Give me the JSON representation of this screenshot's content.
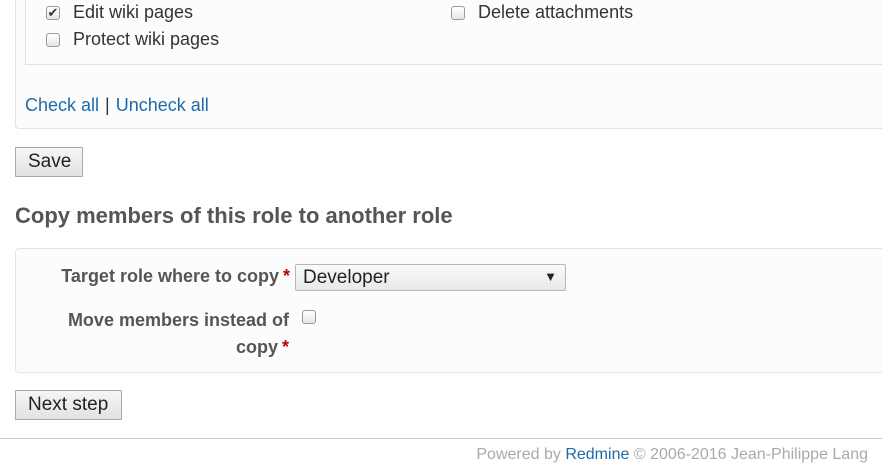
{
  "permissions": {
    "items": [
      {
        "label": "Edit wiki pages",
        "checked": true
      },
      {
        "label": "Delete attachments",
        "checked": false
      },
      {
        "label": "Protect wiki pages",
        "checked": false
      }
    ],
    "check_all": "Check all",
    "separator": "|",
    "uncheck_all": "Uncheck all"
  },
  "save_button": "Save",
  "copy_section": {
    "title": "Copy members of this role to another role",
    "target_label": "Target role where to copy",
    "target_value": "Developer",
    "move_label_line1": "Move members instead of",
    "move_label_line2": "copy",
    "move_checked": false,
    "required_mark": "*"
  },
  "next_button": "Next step",
  "footer": {
    "prefix": "Powered by",
    "link": "Redmine",
    "suffix": "© 2006-2016 Jean-Philippe Lang"
  },
  "colors": {
    "link": "#1e6aa8",
    "required": "#bb0000"
  }
}
